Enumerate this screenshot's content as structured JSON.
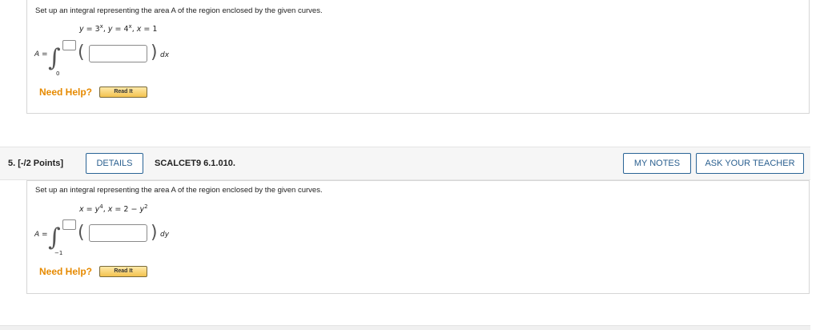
{
  "problem4": {
    "statement": "Set up an integral representing the area A of the region enclosed by the given curves.",
    "eq_y1_var": "y",
    "eq_eq1": " = 3",
    "eq_exp1": "x",
    "eq_sep1": ",   ",
    "eq_y2_var": "y",
    "eq_eq2": " = 4",
    "eq_exp2": "x",
    "eq_sep2": ",   ",
    "eq_x_var": "x",
    "eq_eq3": " = 1",
    "a_label": "A =",
    "lower_limit": "0",
    "upper_limit_value": "",
    "integrand_value": "",
    "differential": "dx",
    "need_help": "Need Help?",
    "read_it": "Read It"
  },
  "problem5": {
    "number_label": "5.  [-/2 Points]",
    "details_button": "DETAILS",
    "code": "SCALCET9 6.1.010.",
    "my_notes_button": "MY NOTES",
    "ask_teacher_button": "ASK YOUR TEACHER",
    "statement": "Set up an integral representing the area A of the region enclosed by the given curves.",
    "eq_x1_var": "x",
    "eq_eq1": " = ",
    "eq_y1_var": "y",
    "eq_exp1": "4",
    "eq_sep": ",   ",
    "eq_x2_var": "x",
    "eq_eq2": " = 2 − ",
    "eq_y2_var": "y",
    "eq_exp2": "2",
    "a_label": "A =",
    "lower_limit": "−1",
    "upper_limit_value": "",
    "integrand_value": "",
    "differential": "dy",
    "need_help": "Need Help?",
    "read_it": "Read It"
  },
  "icons": {
    "integral": "integral-sign",
    "paren": "parentheses"
  },
  "colors": {
    "need_help": "#e68a00",
    "button_text": "#2a5f8f",
    "button_border": "#2a6496"
  }
}
